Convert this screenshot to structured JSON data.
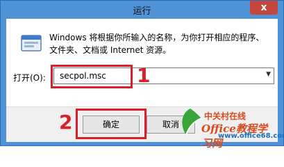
{
  "window": {
    "title": "运行",
    "close_glyph": "x"
  },
  "description": {
    "line1": "Windows 将根据你所输入的名称，为你打开相应的程序、",
    "line2": "文件夹、文档或 Internet 资源。"
  },
  "open_field": {
    "label": "打开(O):",
    "value": "secpol.msc"
  },
  "buttons": {
    "ok": "确定",
    "cancel": "取消"
  },
  "annotations": {
    "step1": "1",
    "step2": "2",
    "highlight_color": "#d8202a"
  },
  "watermark": {
    "site_cn": "中关村在线",
    "site_en": "Office教程学习网",
    "url": "www.office68.com"
  },
  "icons": [
    "run-app-icon",
    "dropdown-arrow-icon",
    "close-icon"
  ]
}
